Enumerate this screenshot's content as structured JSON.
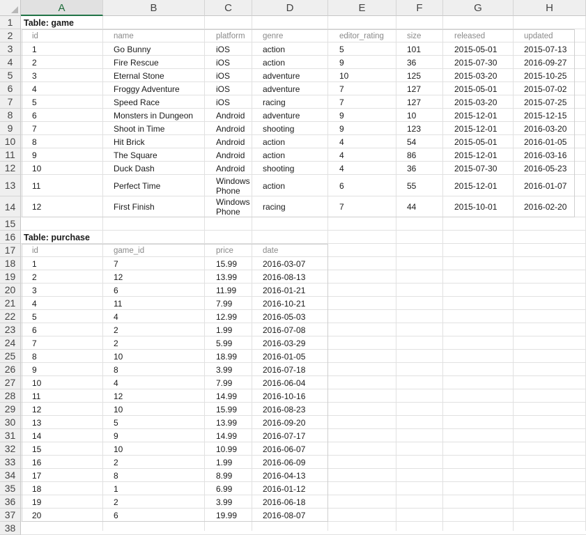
{
  "columns": [
    "A",
    "B",
    "C",
    "D",
    "E",
    "F",
    "G",
    "H"
  ],
  "selected_column": "A",
  "rows": [
    "1",
    "2",
    "3",
    "4",
    "5",
    "6",
    "7",
    "8",
    "9",
    "10",
    "11",
    "12",
    "13",
    "14",
    "15",
    "16",
    "17",
    "18",
    "19",
    "20",
    "21",
    "22",
    "23",
    "24",
    "25",
    "26",
    "27",
    "28",
    "29",
    "30",
    "31",
    "32",
    "33",
    "34",
    "35",
    "36",
    "37",
    "38"
  ],
  "game": {
    "title": "Table: game",
    "headers": [
      "id",
      "name",
      "platform",
      "genre",
      "editor_rating",
      "size",
      "released",
      "updated"
    ],
    "rows": [
      [
        "1",
        "Go Bunny",
        "iOS",
        "action",
        "5",
        "101",
        "2015-05-01",
        "2015-07-13"
      ],
      [
        "2",
        "Fire Rescue",
        "iOS",
        "action",
        "9",
        "36",
        "2015-07-30",
        "2016-09-27"
      ],
      [
        "3",
        "Eternal Stone",
        "iOS",
        "adventure",
        "10",
        "125",
        "2015-03-20",
        "2015-10-25"
      ],
      [
        "4",
        "Froggy Adventure",
        "iOS",
        "adventure",
        "7",
        "127",
        "2015-05-01",
        "2015-07-02"
      ],
      [
        "5",
        "Speed Race",
        "iOS",
        "racing",
        "7",
        "127",
        "2015-03-20",
        "2015-07-25"
      ],
      [
        "6",
        "Monsters in Dungeon",
        "Android",
        "adventure",
        "9",
        "10",
        "2015-12-01",
        "2015-12-15"
      ],
      [
        "7",
        "Shoot in Time",
        "Android",
        "shooting",
        "9",
        "123",
        "2015-12-01",
        "2016-03-20"
      ],
      [
        "8",
        "Hit Brick",
        "Android",
        "action",
        "4",
        "54",
        "2015-05-01",
        "2016-01-05"
      ],
      [
        "9",
        "The Square",
        "Android",
        "action",
        "4",
        "86",
        "2015-12-01",
        "2016-03-16"
      ],
      [
        "10",
        "Duck Dash",
        "Android",
        "shooting",
        "4",
        "36",
        "2015-07-30",
        "2016-05-23"
      ],
      [
        "11",
        "Perfect Time",
        "Windows Phone",
        "action",
        "6",
        "55",
        "2015-12-01",
        "2016-01-07"
      ],
      [
        "12",
        "First Finish",
        "Windows Phone",
        "racing",
        "7",
        "44",
        "2015-10-01",
        "2016-02-20"
      ]
    ]
  },
  "purchase": {
    "title": "Table: purchase",
    "headers": [
      "id",
      "game_id",
      "price",
      "date"
    ],
    "rows": [
      [
        "1",
        "7",
        "15.99",
        "2016-03-07"
      ],
      [
        "2",
        "12",
        "13.99",
        "2016-08-13"
      ],
      [
        "3",
        "6",
        "11.99",
        "2016-01-21"
      ],
      [
        "4",
        "11",
        "7.99",
        "2016-10-21"
      ],
      [
        "5",
        "4",
        "12.99",
        "2016-05-03"
      ],
      [
        "6",
        "2",
        "1.99",
        "2016-07-08"
      ],
      [
        "7",
        "2",
        "5.99",
        "2016-03-29"
      ],
      [
        "8",
        "10",
        "18.99",
        "2016-01-05"
      ],
      [
        "9",
        "8",
        "3.99",
        "2016-07-18"
      ],
      [
        "10",
        "4",
        "7.99",
        "2016-06-04"
      ],
      [
        "11",
        "12",
        "14.99",
        "2016-10-16"
      ],
      [
        "12",
        "10",
        "15.99",
        "2016-08-23"
      ],
      [
        "13",
        "5",
        "13.99",
        "2016-09-20"
      ],
      [
        "14",
        "9",
        "14.99",
        "2016-07-17"
      ],
      [
        "15",
        "10",
        "10.99",
        "2016-06-07"
      ],
      [
        "16",
        "2",
        "1.99",
        "2016-06-09"
      ],
      [
        "17",
        "8",
        "8.99",
        "2016-04-13"
      ],
      [
        "18",
        "1",
        "6.99",
        "2016-01-12"
      ],
      [
        "19",
        "2",
        "3.99",
        "2016-06-18"
      ],
      [
        "20",
        "6",
        "19.99",
        "2016-08-07"
      ]
    ]
  }
}
